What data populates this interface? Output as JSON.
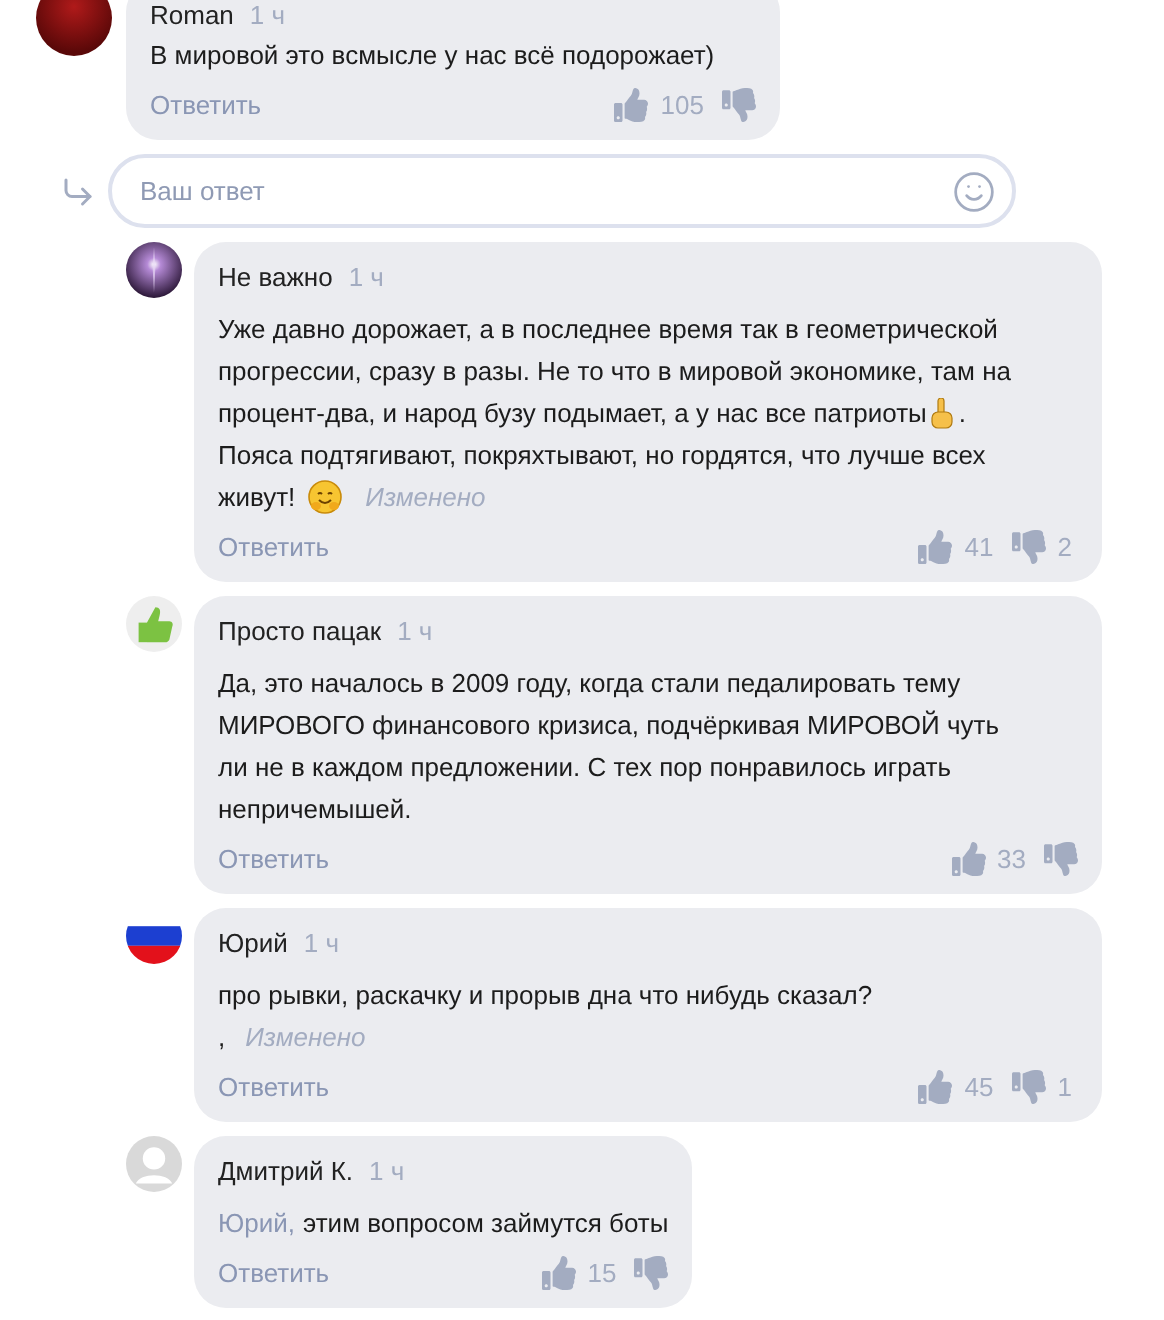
{
  "top_comment": {
    "author": "Roman",
    "time": "1 ч",
    "avatar": {
      "kind": "sphere"
    },
    "lines": [
      [
        {
          "kind": "text",
          "text": "В мировой это всмысле у нас всё подорожает)"
        }
      ]
    ],
    "reply_label": "Ответить",
    "likes": "105"
  },
  "reply_input": {
    "placeholder": "Ваш ответ"
  },
  "replies": [
    {
      "author": "Не важно",
      "time": "1 ч",
      "avatar": {
        "kind": "orb"
      },
      "lines": [
        [
          {
            "kind": "text",
            "text": "Уже давно дорожает, а в последнее время так в геометрической"
          }
        ],
        [
          {
            "kind": "text",
            "text": "прогрессии, сразу в разы. Не то что в мировой экономике, там на"
          }
        ],
        [
          {
            "kind": "text",
            "text": "процент-два, и народ бузу подымает, а у нас все патриоты"
          },
          {
            "kind": "finger"
          },
          {
            "kind": "text",
            "text": "."
          }
        ],
        [
          {
            "kind": "text",
            "text": "Пояса подтягивают, покряхтывают, но гордятся, что лучше всех"
          }
        ],
        [
          {
            "kind": "text",
            "text": "живут!"
          },
          {
            "kind": "hug"
          }
        ]
      ],
      "edited": "Изменено",
      "reply_label": "Ответить",
      "likes": "41",
      "dislikes": "2"
    },
    {
      "author": "Просто пацак",
      "time": "1 ч",
      "avatar": {
        "kind": "thumb"
      },
      "lines": [
        [
          {
            "kind": "text",
            "text": "Да, это началось в 2009 году, когда стали педалировать тему"
          }
        ],
        [
          {
            "kind": "text",
            "text": "МИРОВОГО финансового кризиса, подчёркивая МИРОВОЙ чуть"
          }
        ],
        [
          {
            "kind": "text",
            "text": "ли не в каждом предложении. С тех пор понравилось играть"
          }
        ],
        [
          {
            "kind": "text",
            "text": "непричемышей."
          }
        ]
      ],
      "reply_label": "Ответить",
      "likes": "33"
    },
    {
      "author": "Юрий",
      "time": "1 ч",
      "avatar": {
        "kind": "flag"
      },
      "lines": [
        [
          {
            "kind": "text",
            "text": "про рывки, раскачку и прорыв дна что нибудь сказал?"
          }
        ],
        [
          {
            "kind": "text",
            "text": ","
          }
        ]
      ],
      "edited": "Изменено",
      "reply_label": "Ответить",
      "likes": "45",
      "dislikes": "1"
    },
    {
      "author": "Дмитрий К.",
      "time": "1 ч",
      "avatar": {
        "kind": "default"
      },
      "compact": true,
      "lines": [
        [
          {
            "kind": "addressee",
            "text": "Юрий,"
          },
          {
            "kind": "text",
            "text": "этим вопросом займутся боты"
          }
        ]
      ],
      "reply_label": "Ответить",
      "likes": "15"
    }
  ]
}
